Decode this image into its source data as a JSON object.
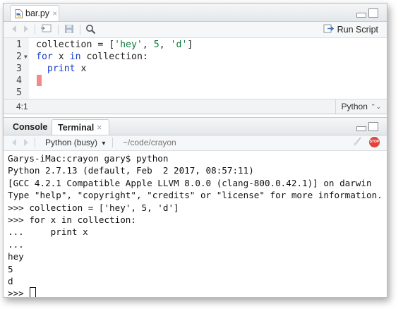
{
  "editor": {
    "tab_label": "bar.py",
    "close_glyph": "×",
    "run_label": "Run Script",
    "lines": [
      {
        "num": "1",
        "code": "collection = ['hey', 5, 'd']"
      },
      {
        "num": "2",
        "code": "for x in collection:"
      },
      {
        "num": "3",
        "code": "  print x"
      },
      {
        "num": "4",
        "code": ""
      },
      {
        "num": "5",
        "code": ""
      }
    ],
    "cursor_position": "4:1",
    "language": "Python",
    "language_arrow": "⌃⌄"
  },
  "console": {
    "tabs": [
      {
        "label": "Console"
      },
      {
        "label": "Terminal"
      }
    ],
    "terminal_close_glyph": "×",
    "session_label": "Python (busy)",
    "session_arrow": "▾",
    "path": "~/code/crayon",
    "stop_label": "STOP",
    "lines": [
      "Garys-iMac:crayon gary$ python",
      "Python 2.7.13 (default, Feb  2 2017, 08:57:11)",
      "[GCC 4.2.1 Compatible Apple LLVM 8.0.0 (clang-800.0.42.1)] on darwin",
      "Type \"help\", \"copyright\", \"credits\" or \"license\" for more information.",
      ">>> collection = ['hey', 5, 'd']",
      ">>> for x in collection:",
      "...     print x",
      "...",
      "hey",
      "5",
      "d"
    ],
    "prompt": ">>> "
  },
  "icons": {
    "file": "python-file-icon",
    "back": "back-arrow-icon",
    "forward": "forward-arrow-icon",
    "show_in_window": "show-in-new-window-icon",
    "save": "save-icon",
    "search": "search-icon",
    "run": "run-script-icon",
    "clear": "clear-console-icon",
    "stop": "stop-icon"
  },
  "colors": {
    "keyword": "#1a3fcf",
    "string": "#0a7a3a",
    "cursor_line": "#f28a8a",
    "stop": "#e0443a"
  }
}
